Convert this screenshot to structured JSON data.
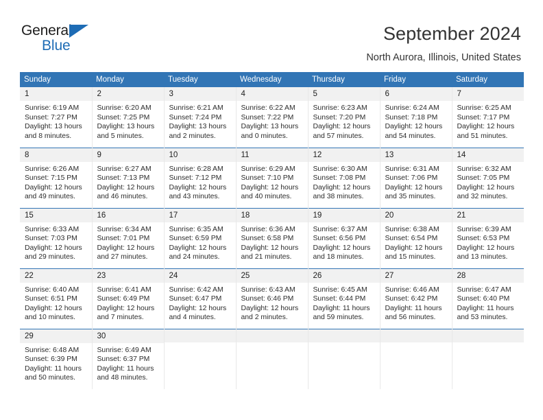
{
  "brand": {
    "name_part1": "General",
    "name_part2": "Blue",
    "triangle_icon": "triangle-logo-icon",
    "accent_color": "#1e6cb5"
  },
  "header": {
    "title": "September 2024",
    "subtitle": "North Aurora, Illinois, United States"
  },
  "colors": {
    "header_band": "#3275b5",
    "daynum_strip": "#f1f1f1",
    "row_divider": "#3275b5",
    "text": "#2b2b2b"
  },
  "calendar": {
    "weekday_headers": [
      "Sunday",
      "Monday",
      "Tuesday",
      "Wednesday",
      "Thursday",
      "Friday",
      "Saturday"
    ],
    "weeks": [
      [
        {
          "day": "1",
          "sunrise": "Sunrise: 6:19 AM",
          "sunset": "Sunset: 7:27 PM",
          "daylight": "Daylight: 13 hours and 8 minutes."
        },
        {
          "day": "2",
          "sunrise": "Sunrise: 6:20 AM",
          "sunset": "Sunset: 7:25 PM",
          "daylight": "Daylight: 13 hours and 5 minutes."
        },
        {
          "day": "3",
          "sunrise": "Sunrise: 6:21 AM",
          "sunset": "Sunset: 7:24 PM",
          "daylight": "Daylight: 13 hours and 2 minutes."
        },
        {
          "day": "4",
          "sunrise": "Sunrise: 6:22 AM",
          "sunset": "Sunset: 7:22 PM",
          "daylight": "Daylight: 13 hours and 0 minutes."
        },
        {
          "day": "5",
          "sunrise": "Sunrise: 6:23 AM",
          "sunset": "Sunset: 7:20 PM",
          "daylight": "Daylight: 12 hours and 57 minutes."
        },
        {
          "day": "6",
          "sunrise": "Sunrise: 6:24 AM",
          "sunset": "Sunset: 7:18 PM",
          "daylight": "Daylight: 12 hours and 54 minutes."
        },
        {
          "day": "7",
          "sunrise": "Sunrise: 6:25 AM",
          "sunset": "Sunset: 7:17 PM",
          "daylight": "Daylight: 12 hours and 51 minutes."
        }
      ],
      [
        {
          "day": "8",
          "sunrise": "Sunrise: 6:26 AM",
          "sunset": "Sunset: 7:15 PM",
          "daylight": "Daylight: 12 hours and 49 minutes."
        },
        {
          "day": "9",
          "sunrise": "Sunrise: 6:27 AM",
          "sunset": "Sunset: 7:13 PM",
          "daylight": "Daylight: 12 hours and 46 minutes."
        },
        {
          "day": "10",
          "sunrise": "Sunrise: 6:28 AM",
          "sunset": "Sunset: 7:12 PM",
          "daylight": "Daylight: 12 hours and 43 minutes."
        },
        {
          "day": "11",
          "sunrise": "Sunrise: 6:29 AM",
          "sunset": "Sunset: 7:10 PM",
          "daylight": "Daylight: 12 hours and 40 minutes."
        },
        {
          "day": "12",
          "sunrise": "Sunrise: 6:30 AM",
          "sunset": "Sunset: 7:08 PM",
          "daylight": "Daylight: 12 hours and 38 minutes."
        },
        {
          "day": "13",
          "sunrise": "Sunrise: 6:31 AM",
          "sunset": "Sunset: 7:06 PM",
          "daylight": "Daylight: 12 hours and 35 minutes."
        },
        {
          "day": "14",
          "sunrise": "Sunrise: 6:32 AM",
          "sunset": "Sunset: 7:05 PM",
          "daylight": "Daylight: 12 hours and 32 minutes."
        }
      ],
      [
        {
          "day": "15",
          "sunrise": "Sunrise: 6:33 AM",
          "sunset": "Sunset: 7:03 PM",
          "daylight": "Daylight: 12 hours and 29 minutes."
        },
        {
          "day": "16",
          "sunrise": "Sunrise: 6:34 AM",
          "sunset": "Sunset: 7:01 PM",
          "daylight": "Daylight: 12 hours and 27 minutes."
        },
        {
          "day": "17",
          "sunrise": "Sunrise: 6:35 AM",
          "sunset": "Sunset: 6:59 PM",
          "daylight": "Daylight: 12 hours and 24 minutes."
        },
        {
          "day": "18",
          "sunrise": "Sunrise: 6:36 AM",
          "sunset": "Sunset: 6:58 PM",
          "daylight": "Daylight: 12 hours and 21 minutes."
        },
        {
          "day": "19",
          "sunrise": "Sunrise: 6:37 AM",
          "sunset": "Sunset: 6:56 PM",
          "daylight": "Daylight: 12 hours and 18 minutes."
        },
        {
          "day": "20",
          "sunrise": "Sunrise: 6:38 AM",
          "sunset": "Sunset: 6:54 PM",
          "daylight": "Daylight: 12 hours and 15 minutes."
        },
        {
          "day": "21",
          "sunrise": "Sunrise: 6:39 AM",
          "sunset": "Sunset: 6:53 PM",
          "daylight": "Daylight: 12 hours and 13 minutes."
        }
      ],
      [
        {
          "day": "22",
          "sunrise": "Sunrise: 6:40 AM",
          "sunset": "Sunset: 6:51 PM",
          "daylight": "Daylight: 12 hours and 10 minutes."
        },
        {
          "day": "23",
          "sunrise": "Sunrise: 6:41 AM",
          "sunset": "Sunset: 6:49 PM",
          "daylight": "Daylight: 12 hours and 7 minutes."
        },
        {
          "day": "24",
          "sunrise": "Sunrise: 6:42 AM",
          "sunset": "Sunset: 6:47 PM",
          "daylight": "Daylight: 12 hours and 4 minutes."
        },
        {
          "day": "25",
          "sunrise": "Sunrise: 6:43 AM",
          "sunset": "Sunset: 6:46 PM",
          "daylight": "Daylight: 12 hours and 2 minutes."
        },
        {
          "day": "26",
          "sunrise": "Sunrise: 6:45 AM",
          "sunset": "Sunset: 6:44 PM",
          "daylight": "Daylight: 11 hours and 59 minutes."
        },
        {
          "day": "27",
          "sunrise": "Sunrise: 6:46 AM",
          "sunset": "Sunset: 6:42 PM",
          "daylight": "Daylight: 11 hours and 56 minutes."
        },
        {
          "day": "28",
          "sunrise": "Sunrise: 6:47 AM",
          "sunset": "Sunset: 6:40 PM",
          "daylight": "Daylight: 11 hours and 53 minutes."
        }
      ],
      [
        {
          "day": "29",
          "sunrise": "Sunrise: 6:48 AM",
          "sunset": "Sunset: 6:39 PM",
          "daylight": "Daylight: 11 hours and 50 minutes."
        },
        {
          "day": "30",
          "sunrise": "Sunrise: 6:49 AM",
          "sunset": "Sunset: 6:37 PM",
          "daylight": "Daylight: 11 hours and 48 minutes."
        },
        {
          "day": "",
          "sunrise": "",
          "sunset": "",
          "daylight": ""
        },
        {
          "day": "",
          "sunrise": "",
          "sunset": "",
          "daylight": ""
        },
        {
          "day": "",
          "sunrise": "",
          "sunset": "",
          "daylight": ""
        },
        {
          "day": "",
          "sunrise": "",
          "sunset": "",
          "daylight": ""
        },
        {
          "day": "",
          "sunrise": "",
          "sunset": "",
          "daylight": ""
        }
      ]
    ]
  }
}
